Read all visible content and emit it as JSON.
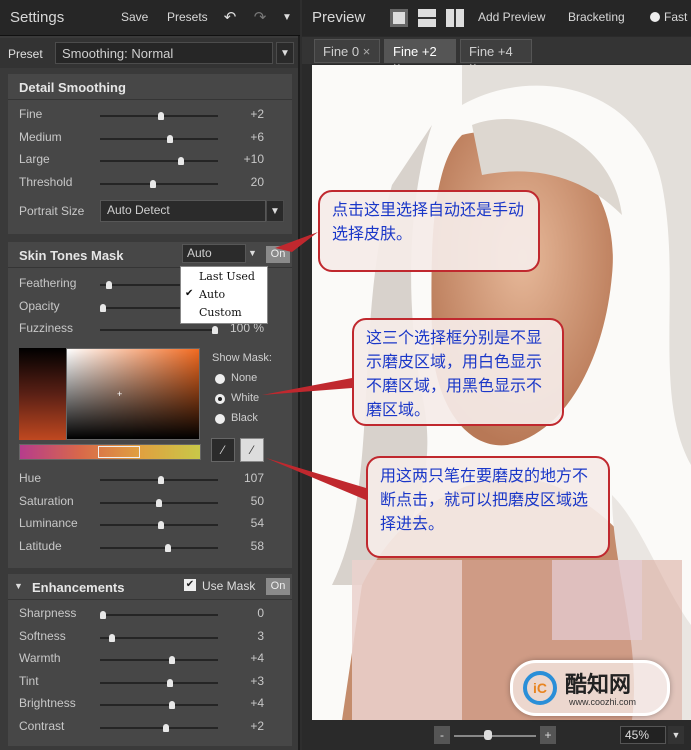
{
  "settings": {
    "title": "Settings",
    "save": "Save",
    "presets": "Presets",
    "icons": [
      "undo-icon",
      "redo-icon",
      "menu-arrow-icon"
    ]
  },
  "preset": {
    "label": "Preset",
    "value": "Smoothing: Normal"
  },
  "detail": {
    "title": "Detail Smoothing",
    "sliders": [
      {
        "label": "Fine",
        "value": "+2",
        "pos": 0.52
      },
      {
        "label": "Medium",
        "value": "+6",
        "pos": 0.6
      },
      {
        "label": "Large",
        "value": "+10",
        "pos": 0.7
      },
      {
        "label": "Threshold",
        "value": "20",
        "pos": 0.45
      }
    ],
    "portrait_label": "Portrait Size",
    "portrait_value": "Auto Detect"
  },
  "skin": {
    "title": "Skin Tones Mask",
    "mode": "Auto",
    "on": "On",
    "dropdown": [
      "Last Used",
      "Auto",
      "Custom"
    ],
    "checked": "✔",
    "sliders": [
      {
        "label": "Feathering",
        "value": "",
        "pos": 0.05
      },
      {
        "label": "Opacity",
        "value": "",
        "pos": 0.0
      },
      {
        "label": "Fuzziness",
        "value": "100 %",
        "pos": 1.0
      }
    ],
    "show_mask": "Show Mask:",
    "mask_options": [
      "None",
      "White",
      "Black"
    ],
    "selected_mask": 1,
    "sliders2": [
      {
        "label": "Hue",
        "value": "107",
        "pos": 0.52
      },
      {
        "label": "Saturation",
        "value": "50",
        "pos": 0.5
      },
      {
        "label": "Luminance",
        "value": "54",
        "pos": 0.52
      },
      {
        "label": "Latitude",
        "value": "58",
        "pos": 0.58
      }
    ]
  },
  "enh": {
    "title": "Enhancements",
    "use_mask": "Use Mask",
    "on": "On",
    "sliders": [
      {
        "label": "Sharpness",
        "value": "0",
        "pos": 0.0
      },
      {
        "label": "Softness",
        "value": "3",
        "pos": 0.08
      },
      {
        "label": "Warmth",
        "value": "+4",
        "pos": 0.62
      },
      {
        "label": "Tint",
        "value": "+3",
        "pos": 0.6
      },
      {
        "label": "Brightness",
        "value": "+4",
        "pos": 0.62
      },
      {
        "label": "Contrast",
        "value": "+2",
        "pos": 0.56
      }
    ]
  },
  "preview": {
    "title": "Preview",
    "add_preview": "Add Preview",
    "bracketing": "Bracketing",
    "fast": "Fast",
    "tabs": [
      "Fine 0",
      "Fine +2",
      "Fine +4"
    ],
    "active_tab": 1,
    "zoom": "45%"
  },
  "callouts": {
    "c1": "点击这里选择自动还是手动选择皮肤。",
    "c2": "这三个选择框分别是不显示磨皮区域，用白色显示不磨区域，用黑色显示不磨区域。",
    "c3": "用这两只笔在要磨皮的地方不断点击，就可以把磨皮区域选择进去。"
  },
  "watermark": {
    "name": "酷知网",
    "url": "www.coozhi.com"
  }
}
